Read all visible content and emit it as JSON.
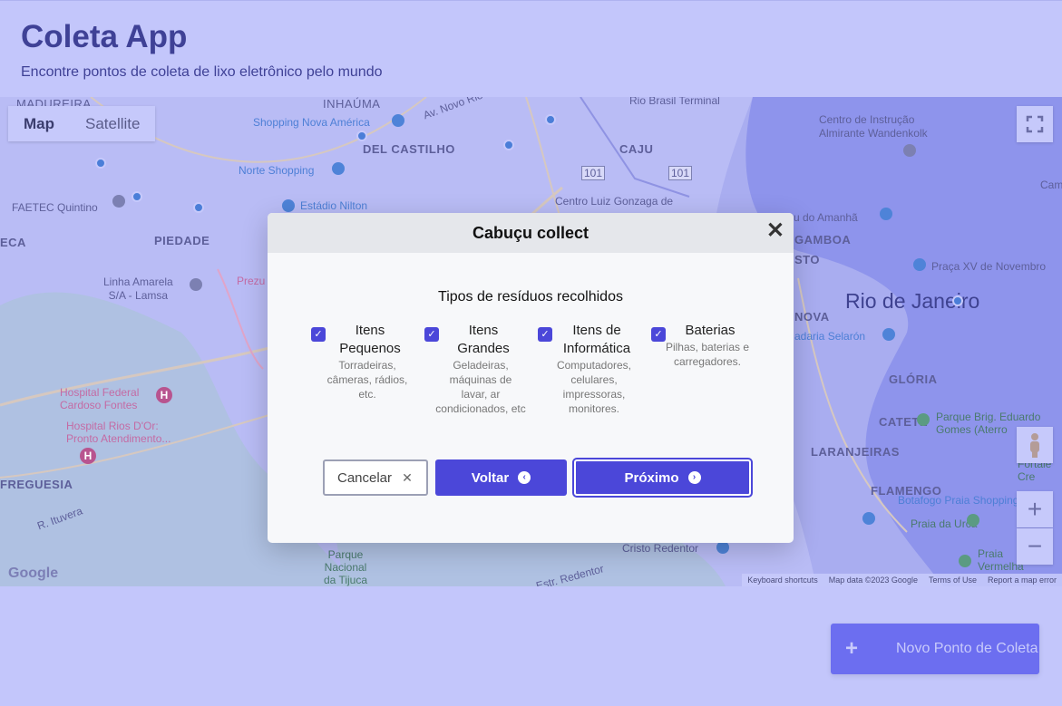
{
  "header": {
    "title": "Coleta App",
    "subtitle": "Encontre pontos de coleta de lixo eletrônico pelo mundo"
  },
  "map": {
    "type_controls": [
      "Map",
      "Satellite"
    ],
    "labels": {
      "madureira": "MADUREIRA",
      "inhauma": "INHAÚMA",
      "av_novo_rio": "Av. Novo Rio",
      "rio_brasil": "Rio Brasil Terminal",
      "shopping_nova_america": "Shopping Nova América",
      "del_castilho": "DEL CASTILHO",
      "caju": "CAJU",
      "centro_instrucao": "Centro de Instrução\nAlmirante Wandenkolk",
      "norte_shopping": "Norte Shopping",
      "faetec": "FAETEC Quintino",
      "estadio": "Estádio Nilton",
      "centro_luiz": "Centro Luiz Gonzaga de",
      "museu_amanha": "u do Amanhã",
      "eca": "ECA",
      "piedade": "PIEDADE",
      "gamboa": "GAMBOA",
      "praca_xv": "Praça XV de Novembro",
      "linha_amarela": "Linha Amarela\nS/A - Lamsa",
      "prezu": "Prezu",
      "rio": "Rio de Janeiro",
      "nova": "NOVA",
      "selaron": "adaria Selarón",
      "hospital_federal": "Hospital Federal\nCardoso Fontes",
      "gloria": "GLÓRIA",
      "hospital_rios": "Hospital Rios D'Or:\nPronto Atendimento...",
      "catete": "CATETE",
      "parque_brig": "Parque Brig. Eduardo\nGomes (Aterro",
      "laranjeiras": "LARANJEIRAS",
      "freguesia": "FREGUESIA",
      "flamengo": "FLAMENGO",
      "botafogo_shopping": "Botafogo Praia Shopping",
      "praia_urca": "Praia da Urca",
      "parque_nacional": "Parque\nNacional\nda Tijuca",
      "cristo": "Cristo Redentor",
      "praia_vermelha": "Praia\nVermelha",
      "cam": "Cam",
      "forte": "Fortale\nCre",
      "sto": "STO",
      "r_ruvera": "R. Ituvera",
      "estr_redentor": "Estr. Redentor"
    },
    "footer": [
      "Keyboard shortcuts",
      "Map data ©2023 Google",
      "Terms of Use",
      "Report a map error"
    ],
    "google_logo": "Google",
    "shield_101": "101"
  },
  "modal": {
    "title": "Cabuçu collect",
    "subtitle": "Tipos de resíduos recolhidos",
    "types": [
      {
        "title": "Itens Pequenos",
        "desc": "Torradeiras, câmeras, rádios, etc.",
        "checked": true
      },
      {
        "title": "Itens Grandes",
        "desc": "Geladeiras, máquinas de lavar, ar condicionados, etc",
        "checked": true
      },
      {
        "title": "Itens de Informática",
        "desc": "Computadores, celulares, impressoras, monitores.",
        "checked": true
      },
      {
        "title": "Baterias",
        "desc": "Pilhas, baterias e carregadores.",
        "checked": true
      }
    ],
    "buttons": {
      "cancel": "Cancelar",
      "back": "Voltar",
      "next": "Próximo"
    }
  },
  "fab": {
    "label": "Novo Ponto de Coleta"
  }
}
